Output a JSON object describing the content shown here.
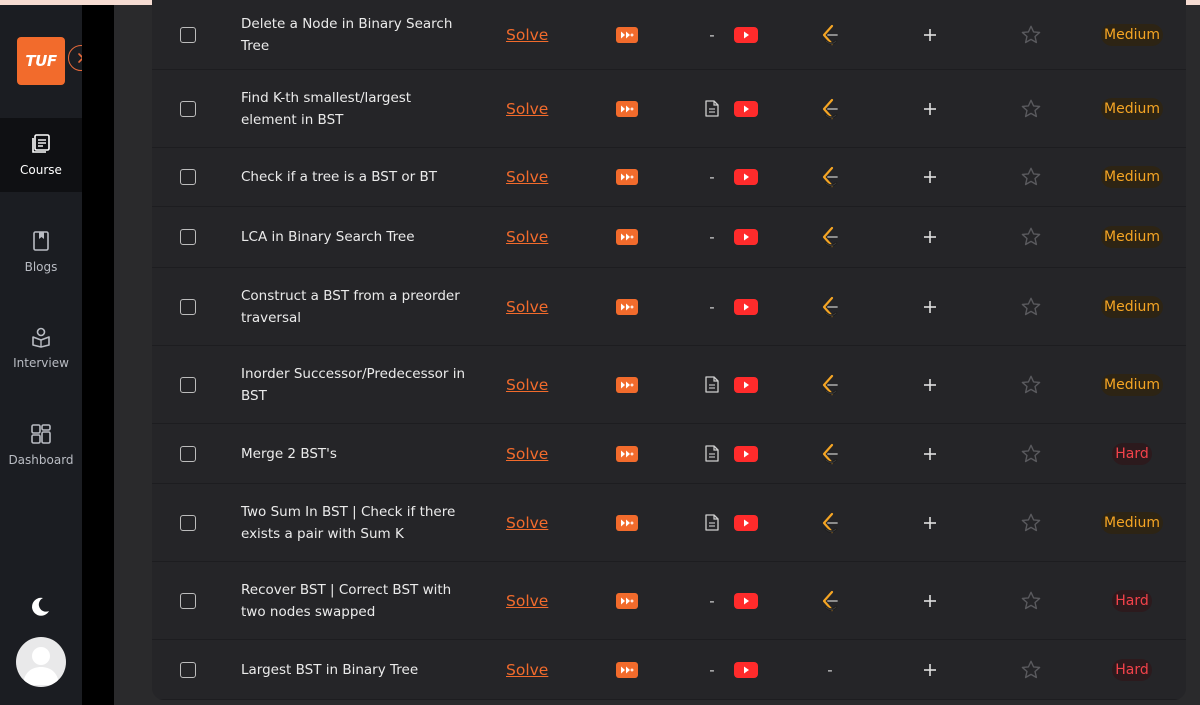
{
  "sidebar": {
    "logo_text": "TUF",
    "items": [
      {
        "label": "Course",
        "icon": "course-icon",
        "active": true
      },
      {
        "label": "Blogs",
        "icon": "bookmark-icon",
        "active": false
      },
      {
        "label": "Interview",
        "icon": "interview-icon",
        "active": false
      },
      {
        "label": "Dashboard",
        "icon": "dashboard-icon",
        "active": false
      }
    ]
  },
  "problems": {
    "solve_label": "Solve",
    "rows": [
      {
        "title": "Delete a Node in Binary Search Tree",
        "article": false,
        "leetcode": true,
        "difficulty": "Medium"
      },
      {
        "title": "Find K-th smallest/largest element in BST",
        "article": true,
        "leetcode": true,
        "difficulty": "Medium"
      },
      {
        "title": "Check if a tree is a BST or BT",
        "article": false,
        "leetcode": true,
        "difficulty": "Medium"
      },
      {
        "title": "LCA in Binary Search Tree",
        "article": false,
        "leetcode": true,
        "difficulty": "Medium"
      },
      {
        "title": "Construct a BST from a preorder traversal",
        "article": false,
        "leetcode": true,
        "difficulty": "Medium"
      },
      {
        "title": "Inorder Successor/Predecessor in BST",
        "article": true,
        "leetcode": true,
        "difficulty": "Medium"
      },
      {
        "title": "Merge 2 BST's",
        "article": true,
        "leetcode": true,
        "difficulty": "Hard"
      },
      {
        "title": "Two Sum In BST | Check if there exists a pair with Sum K",
        "article": true,
        "leetcode": true,
        "difficulty": "Medium"
      },
      {
        "title": "Recover BST | Correct BST with two nodes swapped",
        "article": false,
        "leetcode": true,
        "difficulty": "Hard"
      },
      {
        "title": "Largest BST in Binary Tree",
        "article": false,
        "leetcode": false,
        "difficulty": "Hard"
      }
    ]
  },
  "placeholders": {
    "dash": "-"
  },
  "colors": {
    "accent": "#f26b2c",
    "youtube": "#ff2b2b",
    "medium": "#f5a524",
    "hard": "#f2424a"
  }
}
